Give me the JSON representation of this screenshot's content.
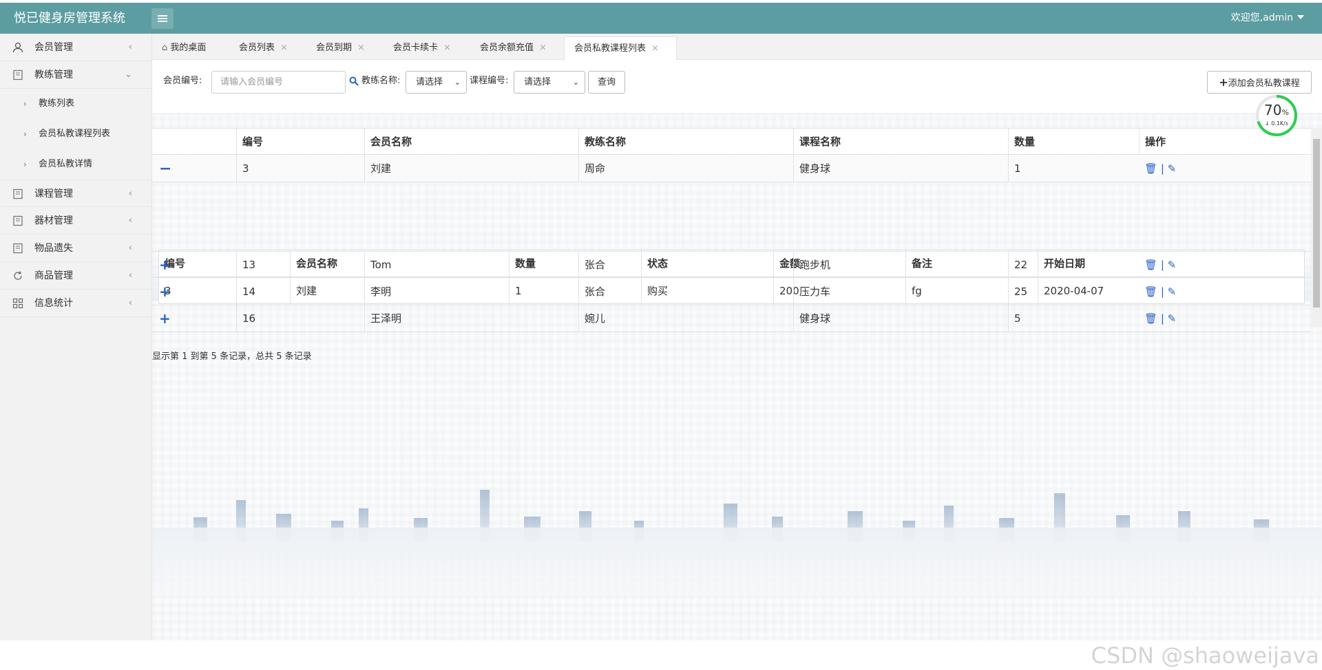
{
  "app": {
    "title": "悦已健身房管理系统",
    "welcome": "欢迎您,admin"
  },
  "sidebar": {
    "items": [
      {
        "label": "会员管理",
        "arrow": "‹"
      },
      {
        "label": "教练管理",
        "arrow": "⌄"
      },
      {
        "label": "课程管理",
        "arrow": "‹"
      },
      {
        "label": "器材管理",
        "arrow": "‹"
      },
      {
        "label": "物品遗失",
        "arrow": "‹"
      },
      {
        "label": "商品管理",
        "arrow": "‹"
      },
      {
        "label": "信息统计",
        "arrow": "‹"
      }
    ],
    "subitems": [
      {
        "label": "教练列表"
      },
      {
        "label": "会员私教课程列表"
      },
      {
        "label": "会员私教详情"
      }
    ]
  },
  "tabs": [
    {
      "label": "我的桌面"
    },
    {
      "label": "会员列表",
      "close": "×"
    },
    {
      "label": "会员到期",
      "close": "×"
    },
    {
      "label": "会员卡续卡",
      "close": "×"
    },
    {
      "label": "会员余额充值",
      "close": "×"
    },
    {
      "label": "会员私教课程列表",
      "close": "×"
    }
  ],
  "filters": {
    "member_id_label": "会员编号:",
    "member_id_placeholder": "请输入会员编号",
    "coach_label": "教练名称:",
    "coach_value": "请选择",
    "course_label": "课程编号:",
    "course_value": "请选择",
    "query": "查询",
    "add": "添加会员私教课程"
  },
  "gauge": {
    "percent": "70",
    "unit": "%",
    "speed": "0.1K/s"
  },
  "table": {
    "headers": [
      "编号",
      "会员名称",
      "教练名称",
      "课程名称",
      "数量",
      "操作"
    ],
    "rows": [
      {
        "toggle": "−",
        "id": "3",
        "member": "刘建",
        "coach": "周命",
        "course": "健身球",
        "qty": "1"
      },
      {
        "toggle": "+",
        "id": "13",
        "member": "Tom",
        "coach": "张合",
        "course": "跑步机",
        "qty": "22"
      },
      {
        "toggle": "+",
        "id": "14",
        "member": "李明",
        "coach": "张合",
        "course": "压力车",
        "qty": "25"
      },
      {
        "toggle": "+",
        "id": "16",
        "member": "王泽明",
        "coach": "婉儿",
        "course": "健身球",
        "qty": "5"
      }
    ],
    "ops": "🗑 | ✎"
  },
  "detail": {
    "headers": [
      "编号",
      "会员名称",
      "数量",
      "状态",
      "金额",
      "备注",
      "开始日期"
    ],
    "row": [
      "3",
      "刘建",
      "1",
      "购买",
      "200",
      "fg",
      "2020-04-07"
    ]
  },
  "pager": "显示第 1 到第 5 条记录，总共 5 条记录",
  "watermark": "CSDN @shaoweijava"
}
